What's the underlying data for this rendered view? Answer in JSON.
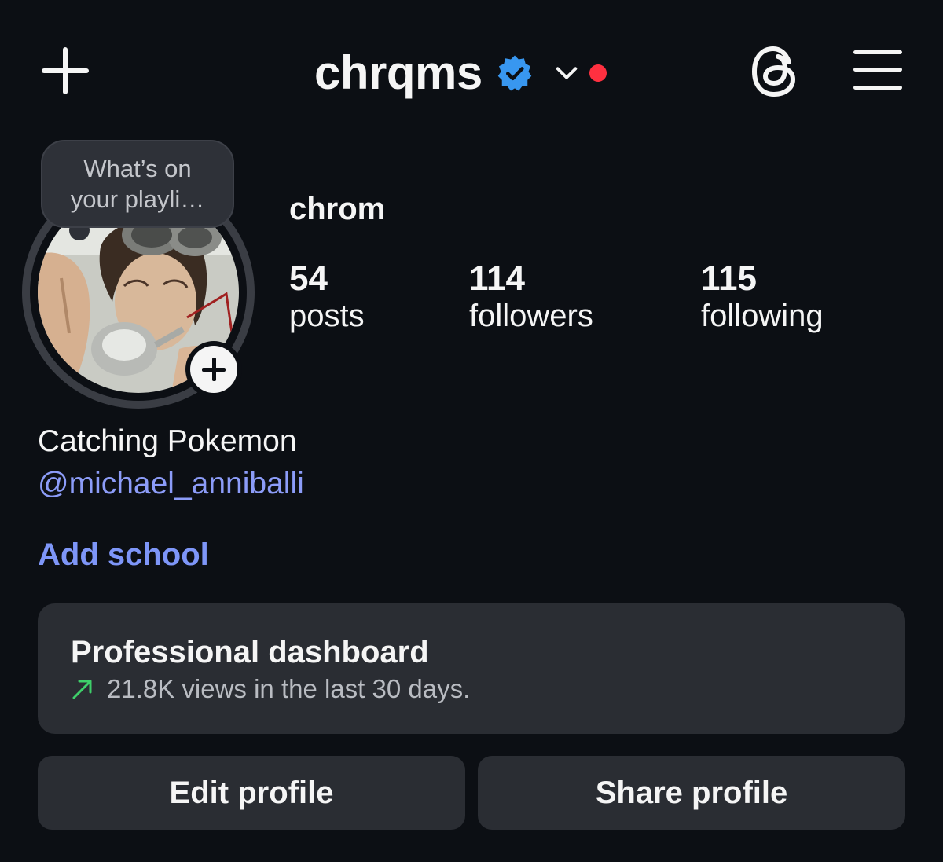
{
  "header": {
    "username": "chrqms",
    "icons": [
      "plus-icon",
      "verified-badge-icon",
      "chevron-down-icon",
      "notification-dot",
      "threads-icon",
      "menu-icon"
    ],
    "accent_verified": "#3897f0",
    "notification_color": "#ff3040"
  },
  "note": {
    "line1": "What’s on",
    "line2": "your playli…"
  },
  "profile": {
    "display_name": "chrom",
    "stats": [
      {
        "value": "54",
        "label": "posts"
      },
      {
        "value": "114",
        "label": "followers"
      },
      {
        "value": "115",
        "label": "following"
      }
    ],
    "bio": "Catching Pokemon",
    "mention": "@michael_anniballi",
    "add_school": "Add school",
    "link_color": "#8c9cf8"
  },
  "dashboard": {
    "title": "Professional dashboard",
    "subtitle": "21.8K views in the last 30 days.",
    "trend_color": "#3ecf6a"
  },
  "buttons": {
    "edit": "Edit profile",
    "share": "Share profile"
  }
}
